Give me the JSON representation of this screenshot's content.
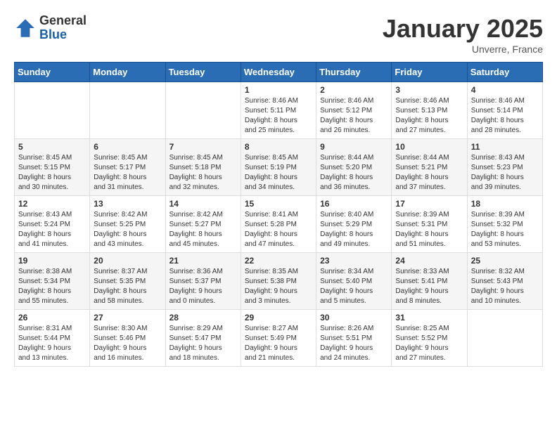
{
  "logo": {
    "general": "General",
    "blue": "Blue"
  },
  "title": "January 2025",
  "location": "Unverre, France",
  "days_header": [
    "Sunday",
    "Monday",
    "Tuesday",
    "Wednesday",
    "Thursday",
    "Friday",
    "Saturday"
  ],
  "weeks": [
    [
      {
        "day": "",
        "info": ""
      },
      {
        "day": "",
        "info": ""
      },
      {
        "day": "",
        "info": ""
      },
      {
        "day": "1",
        "info": "Sunrise: 8:46 AM\nSunset: 5:11 PM\nDaylight: 8 hours\nand 25 minutes."
      },
      {
        "day": "2",
        "info": "Sunrise: 8:46 AM\nSunset: 5:12 PM\nDaylight: 8 hours\nand 26 minutes."
      },
      {
        "day": "3",
        "info": "Sunrise: 8:46 AM\nSunset: 5:13 PM\nDaylight: 8 hours\nand 27 minutes."
      },
      {
        "day": "4",
        "info": "Sunrise: 8:46 AM\nSunset: 5:14 PM\nDaylight: 8 hours\nand 28 minutes."
      }
    ],
    [
      {
        "day": "5",
        "info": "Sunrise: 8:45 AM\nSunset: 5:15 PM\nDaylight: 8 hours\nand 30 minutes."
      },
      {
        "day": "6",
        "info": "Sunrise: 8:45 AM\nSunset: 5:17 PM\nDaylight: 8 hours\nand 31 minutes."
      },
      {
        "day": "7",
        "info": "Sunrise: 8:45 AM\nSunset: 5:18 PM\nDaylight: 8 hours\nand 32 minutes."
      },
      {
        "day": "8",
        "info": "Sunrise: 8:45 AM\nSunset: 5:19 PM\nDaylight: 8 hours\nand 34 minutes."
      },
      {
        "day": "9",
        "info": "Sunrise: 8:44 AM\nSunset: 5:20 PM\nDaylight: 8 hours\nand 36 minutes."
      },
      {
        "day": "10",
        "info": "Sunrise: 8:44 AM\nSunset: 5:21 PM\nDaylight: 8 hours\nand 37 minutes."
      },
      {
        "day": "11",
        "info": "Sunrise: 8:43 AM\nSunset: 5:23 PM\nDaylight: 8 hours\nand 39 minutes."
      }
    ],
    [
      {
        "day": "12",
        "info": "Sunrise: 8:43 AM\nSunset: 5:24 PM\nDaylight: 8 hours\nand 41 minutes."
      },
      {
        "day": "13",
        "info": "Sunrise: 8:42 AM\nSunset: 5:25 PM\nDaylight: 8 hours\nand 43 minutes."
      },
      {
        "day": "14",
        "info": "Sunrise: 8:42 AM\nSunset: 5:27 PM\nDaylight: 8 hours\nand 45 minutes."
      },
      {
        "day": "15",
        "info": "Sunrise: 8:41 AM\nSunset: 5:28 PM\nDaylight: 8 hours\nand 47 minutes."
      },
      {
        "day": "16",
        "info": "Sunrise: 8:40 AM\nSunset: 5:29 PM\nDaylight: 8 hours\nand 49 minutes."
      },
      {
        "day": "17",
        "info": "Sunrise: 8:39 AM\nSunset: 5:31 PM\nDaylight: 8 hours\nand 51 minutes."
      },
      {
        "day": "18",
        "info": "Sunrise: 8:39 AM\nSunset: 5:32 PM\nDaylight: 8 hours\nand 53 minutes."
      }
    ],
    [
      {
        "day": "19",
        "info": "Sunrise: 8:38 AM\nSunset: 5:34 PM\nDaylight: 8 hours\nand 55 minutes."
      },
      {
        "day": "20",
        "info": "Sunrise: 8:37 AM\nSunset: 5:35 PM\nDaylight: 8 hours\nand 58 minutes."
      },
      {
        "day": "21",
        "info": "Sunrise: 8:36 AM\nSunset: 5:37 PM\nDaylight: 9 hours\nand 0 minutes."
      },
      {
        "day": "22",
        "info": "Sunrise: 8:35 AM\nSunset: 5:38 PM\nDaylight: 9 hours\nand 3 minutes."
      },
      {
        "day": "23",
        "info": "Sunrise: 8:34 AM\nSunset: 5:40 PM\nDaylight: 9 hours\nand 5 minutes."
      },
      {
        "day": "24",
        "info": "Sunrise: 8:33 AM\nSunset: 5:41 PM\nDaylight: 9 hours\nand 8 minutes."
      },
      {
        "day": "25",
        "info": "Sunrise: 8:32 AM\nSunset: 5:43 PM\nDaylight: 9 hours\nand 10 minutes."
      }
    ],
    [
      {
        "day": "26",
        "info": "Sunrise: 8:31 AM\nSunset: 5:44 PM\nDaylight: 9 hours\nand 13 minutes."
      },
      {
        "day": "27",
        "info": "Sunrise: 8:30 AM\nSunset: 5:46 PM\nDaylight: 9 hours\nand 16 minutes."
      },
      {
        "day": "28",
        "info": "Sunrise: 8:29 AM\nSunset: 5:47 PM\nDaylight: 9 hours\nand 18 minutes."
      },
      {
        "day": "29",
        "info": "Sunrise: 8:27 AM\nSunset: 5:49 PM\nDaylight: 9 hours\nand 21 minutes."
      },
      {
        "day": "30",
        "info": "Sunrise: 8:26 AM\nSunset: 5:51 PM\nDaylight: 9 hours\nand 24 minutes."
      },
      {
        "day": "31",
        "info": "Sunrise: 8:25 AM\nSunset: 5:52 PM\nDaylight: 9 hours\nand 27 minutes."
      },
      {
        "day": "",
        "info": ""
      }
    ]
  ]
}
